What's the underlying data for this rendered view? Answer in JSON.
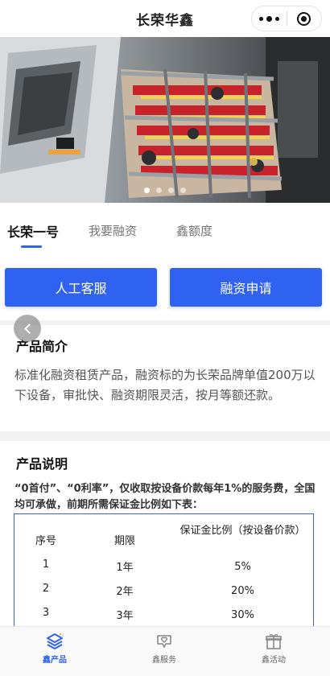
{
  "navbar": {
    "title": "长荣华鑫",
    "more_icon": "more-dots-icon",
    "close_icon": "target-icon"
  },
  "banner": {
    "image": "printing-press-photo",
    "slide_count": 4,
    "active_slide": 1
  },
  "tabs": [
    {
      "label": "长荣一号",
      "active": true
    },
    {
      "label": "我要融资",
      "active": false
    },
    {
      "label": "鑫额度",
      "active": false
    }
  ],
  "actions": {
    "service_label": "人工客服",
    "apply_label": "融资申请"
  },
  "intro": {
    "title": "产品简介",
    "text": "标准化融资租赁产品，融资标的为长荣品牌单值200万以下设备，审批快、融资期限灵活，按月等额还款。"
  },
  "description": {
    "title": "产品说明",
    "lead": "“0首付”、“0利率”，仅收取按设备价款每年1%的服务费，全国均可承做，前期所需保证金比例如下表：",
    "table": {
      "headers": [
        "序号",
        "期限",
        "保证金比例（按设备价款）"
      ],
      "rows": [
        [
          "1",
          "1年",
          "5%"
        ],
        [
          "2",
          "2年",
          "20%"
        ],
        [
          "3",
          "3年",
          "30%"
        ]
      ]
    }
  },
  "tabbar": [
    {
      "label": "鑫产品",
      "icon": "layers-icon",
      "active": true
    },
    {
      "label": "鑫服务",
      "icon": "heart-chat-icon",
      "active": false
    },
    {
      "label": "鑫活动",
      "icon": "gift-icon",
      "active": false
    }
  ],
  "colors": {
    "accent": "#2f62f1",
    "table_border": "#3a68d8"
  }
}
